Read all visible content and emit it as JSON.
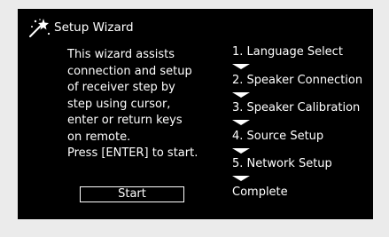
{
  "title": "Setup Wizard",
  "description": "This wizard assists\nconnection and setup\nof receiver step by\nstep using cursor,\nenter or return keys\non remote.\nPress [ENTER] to start.",
  "start_button": "Start",
  "steps": [
    "1. Language Select",
    "2. Speaker Connection",
    "3. Speaker Calibration",
    "4. Source Setup",
    "5. Network Setup",
    "Complete"
  ],
  "colors": {
    "screen": "#000000",
    "text": "#ffffff",
    "page": "#ebebeb"
  }
}
